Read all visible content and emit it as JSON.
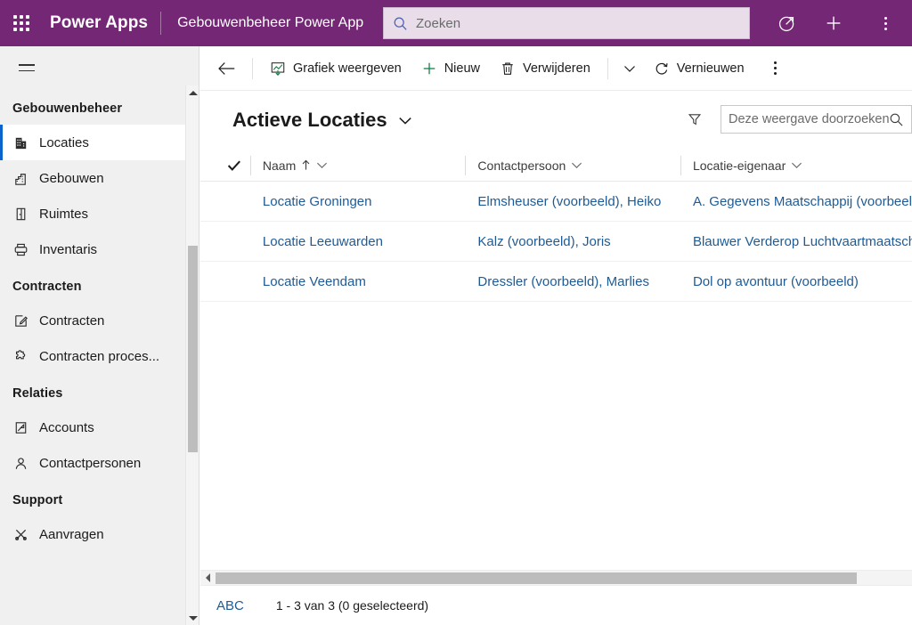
{
  "topbar": {
    "waffle_label": "app-launcher",
    "brand": "Power Apps",
    "app_name": "Gebouwenbeheer Power App",
    "search_placeholder": "Zoeken",
    "search_value": "",
    "icons": {
      "search": "search-icon",
      "launch": "launch-circle-icon",
      "plus": "plus-icon",
      "more": "more-vertical-icon"
    },
    "accent_color": "#742774",
    "search_bg": "#e9dde9"
  },
  "sidebar": {
    "hamburger_label": "Menu samenvouwen",
    "groups": [
      {
        "title": "Gebouwenbeheer",
        "items": [
          {
            "label": "Locaties",
            "icon": "building-icon",
            "selected": true
          },
          {
            "label": "Gebouwen",
            "icon": "buildings-icon",
            "selected": false
          },
          {
            "label": "Ruimtes",
            "icon": "door-icon",
            "selected": false
          },
          {
            "label": "Inventaris",
            "icon": "printer-icon",
            "selected": false
          }
        ]
      },
      {
        "title": "Contracten",
        "items": [
          {
            "label": "Contracten",
            "icon": "edit-square-icon",
            "selected": false
          },
          {
            "label": "Contracten proces...",
            "icon": "puzzle-icon",
            "selected": false
          }
        ]
      },
      {
        "title": "Relaties",
        "items": [
          {
            "label": "Accounts",
            "icon": "account-icon",
            "selected": false
          },
          {
            "label": "Contactpersonen",
            "icon": "person-icon",
            "selected": false
          }
        ]
      },
      {
        "title": "Support",
        "items": [
          {
            "label": "Aanvragen",
            "icon": "tools-icon",
            "selected": false
          }
        ]
      }
    ],
    "selected_accent": "#0b63ce"
  },
  "commandbar": {
    "back_label": "Terug",
    "buttons": [
      {
        "label": "Grafiek weergeven",
        "icon": "chart-icon"
      },
      {
        "label": "Nieuw",
        "icon": "plus-icon"
      },
      {
        "label": "Verwijderen",
        "icon": "trash-icon"
      },
      {
        "label": "Vernieuwen",
        "icon": "refresh-icon"
      }
    ],
    "overflow_chevron": "chevron-down-icon",
    "more_label": "more-vertical-icon"
  },
  "view": {
    "title": "Actieve Locaties",
    "title_chevron": "chevron-down-icon",
    "filter_icon": "filter-icon",
    "search_placeholder": "Deze weergave doorzoeken",
    "search_value": "",
    "search_icon": "search-icon"
  },
  "grid": {
    "select_all_icon": "checkmark-icon",
    "columns": [
      {
        "label": "Naam",
        "sort": "ascending",
        "sort_icon": "arrow-up-icon",
        "chevron": "chevron-down-icon"
      },
      {
        "label": "Contactpersoon",
        "sort": "",
        "sort_icon": "",
        "chevron": "chevron-down-icon"
      },
      {
        "label": "Locatie-eigenaar",
        "sort": "",
        "sort_icon": "",
        "chevron": "chevron-down-icon"
      }
    ],
    "rows": [
      {
        "naam": "Locatie Groningen",
        "contactpersoon": "Elmsheuser (voorbeeld), Heiko",
        "locatie_eigenaar": "A. Gegevens Maatschappij (voorbeeld)"
      },
      {
        "naam": "Locatie Leeuwarden",
        "contactpersoon": "Kalz (voorbeeld), Joris",
        "locatie_eigenaar": "Blauwer Verderop Luchtvaartmaatschappij"
      },
      {
        "naam": "Locatie Veendam",
        "contactpersoon": "Dressler (voorbeeld), Marlies",
        "locatie_eigenaar": "Dol op avontuur (voorbeeld)"
      }
    ],
    "link_color": "#1e5b96"
  },
  "footer": {
    "alpha_index": "ABC",
    "record_count": "1 - 3 van 3 (0 geselecteerd)"
  }
}
